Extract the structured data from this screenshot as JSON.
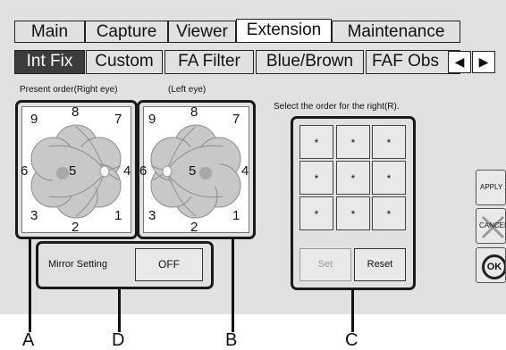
{
  "tabs_top": [
    {
      "label": "Main",
      "active": false
    },
    {
      "label": "Capture",
      "active": false
    },
    {
      "label": "Viewer",
      "active": false
    },
    {
      "label": "Extension",
      "active": true
    },
    {
      "label": "Maintenance",
      "active": false
    }
  ],
  "tabs_sub": [
    {
      "label": "Int Fix",
      "selected": true
    },
    {
      "label": "Custom",
      "selected": false
    },
    {
      "label": "FA Filter",
      "selected": false
    },
    {
      "label": "Blue/Brown",
      "selected": false
    },
    {
      "label": "FAF Obs",
      "selected": false
    }
  ],
  "scroll_left_glyph": "◀",
  "scroll_right_glyph": "▶",
  "present_order_label": "Present order(Right eye)",
  "left_eye_label": "(Left eye)",
  "select_label": "Select the order for the right(R).",
  "right_eye_numbers": [
    "9",
    "8",
    "7",
    "6",
    "5",
    "4",
    "3",
    "2",
    "1"
  ],
  "left_eye_numbers": [
    "9",
    "8",
    "7",
    "6",
    "5",
    "4",
    "3",
    "2",
    "1"
  ],
  "order_grid": [
    "*",
    "*",
    "*",
    "*",
    "*",
    "*",
    "*",
    "*",
    "*"
  ],
  "set_label": "Set",
  "reset_label": "Reset",
  "mirror_label": "Mirror Setting",
  "mirror_value": "OFF",
  "apply_label": "APPLY",
  "cancel_label": "CANCEL",
  "ok_label": "OK",
  "callouts": [
    "A",
    "D",
    "B",
    "C"
  ],
  "colors": {
    "panel": "#e1e1e1",
    "selected_tab": "#3c3c3c",
    "frame": "#1a1a1a"
  }
}
